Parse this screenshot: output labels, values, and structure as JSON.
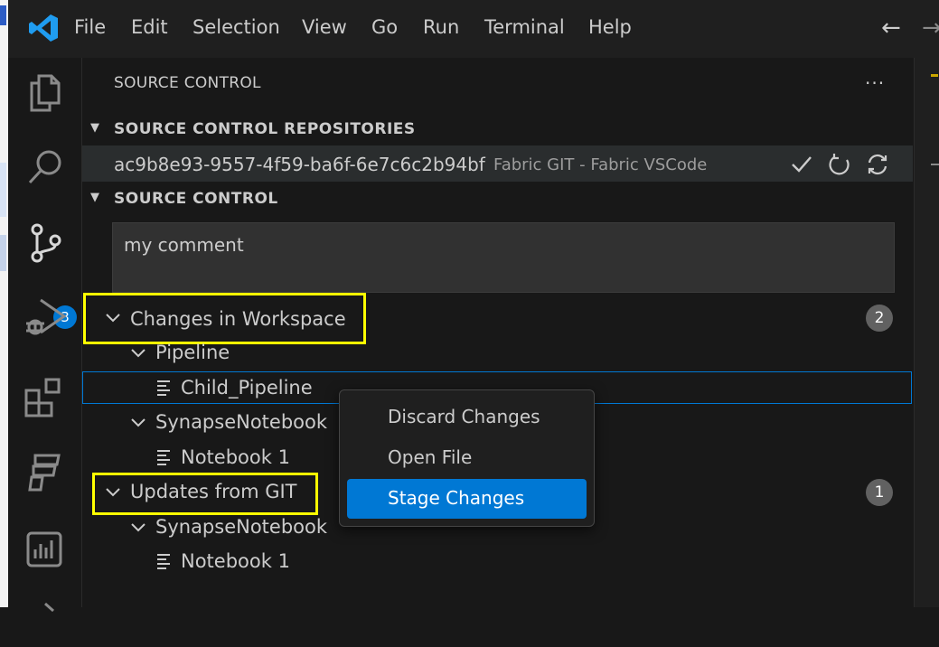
{
  "menu": {
    "file": "File",
    "edit": "Edit",
    "selection": "Selection",
    "view": "View",
    "go": "Go",
    "run": "Run",
    "terminal": "Terminal",
    "help": "Help"
  },
  "nav": {
    "back": "←",
    "forward": "→"
  },
  "activity": {
    "scm_badge": "3"
  },
  "sidebar": {
    "title": "SOURCE CONTROL",
    "more": "···",
    "repositories_header": "SOURCE CONTROL REPOSITORIES",
    "repo": {
      "id": "ac9b8e93-9557-4f59-ba6f-6e7c6c2b94bf",
      "description": "Fabric GIT - Fabric VSCode"
    },
    "scm_header": "SOURCE CONTROL",
    "commit_message": "my comment",
    "groups": [
      {
        "label": "Changes in Workspace",
        "count": "2",
        "folders": [
          {
            "label": "Pipeline",
            "files": [
              "Child_Pipeline"
            ]
          },
          {
            "label": "SynapseNotebook",
            "files": [
              "Notebook 1"
            ]
          }
        ]
      },
      {
        "label": "Updates from GIT",
        "count": "1",
        "folders": [
          {
            "label": "SynapseNotebook",
            "files": [
              "Notebook 1"
            ]
          }
        ]
      }
    ]
  },
  "context_menu": {
    "discard": "Discard Changes",
    "open": "Open File",
    "stage": "Stage Changes"
  },
  "colors": {
    "accent": "#0078d4",
    "highlight": "#ffff00",
    "background": "#181818"
  }
}
